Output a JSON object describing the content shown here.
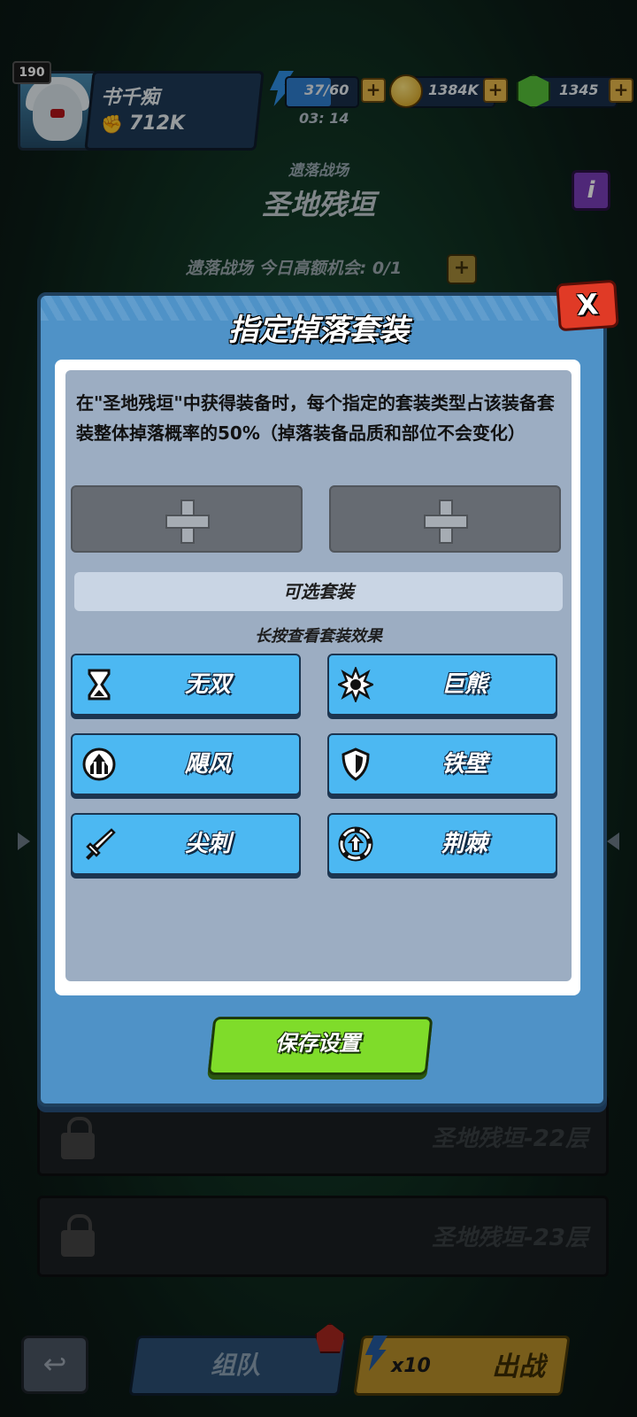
{
  "player": {
    "level": "190",
    "name": "书千痴",
    "power": "712K"
  },
  "resources": {
    "stamina": "37/60",
    "stamina_timer": "03: 14",
    "stamina_fill": 0.62,
    "coins": "1384K",
    "gems": "1345"
  },
  "stage": {
    "subtitle": "遗落战场",
    "title": "圣地残垣",
    "info_label": "i",
    "chance": "遗落战场 今日高额机会: 0/1"
  },
  "floors": [
    {
      "name": "圣地残垣-22层"
    },
    {
      "name": "圣地残垣-23层"
    }
  ],
  "modal": {
    "title": "指定掉落套装",
    "close_label": "X",
    "description": "在\"圣地残垣\"中获得装备时，每个指定的套装类型占该装备套装整体掉落概率的50%（掉落装备品质和部位不会变化）",
    "options_header": "可选套装",
    "hint": "长按查看套装效果",
    "sets": [
      {
        "label": "无双",
        "icon": "hourglass-icon"
      },
      {
        "label": "巨熊",
        "icon": "burst-icon"
      },
      {
        "label": "飓风",
        "icon": "cyclone-icon"
      },
      {
        "label": "铁壁",
        "icon": "shield-icon"
      },
      {
        "label": "尖刺",
        "icon": "sword-icon"
      },
      {
        "label": "荆棘",
        "icon": "thorn-cycle-icon"
      }
    ],
    "save_label": "保存设置"
  },
  "bottom": {
    "team_label": "组队",
    "fight_cost": "x10",
    "fight_label": "出战"
  },
  "colors": {
    "modal_bg": "#4f92c7",
    "set_button": "#4cb8f2",
    "save_button": "#7fdc2a",
    "close_button": "#e03a26"
  }
}
